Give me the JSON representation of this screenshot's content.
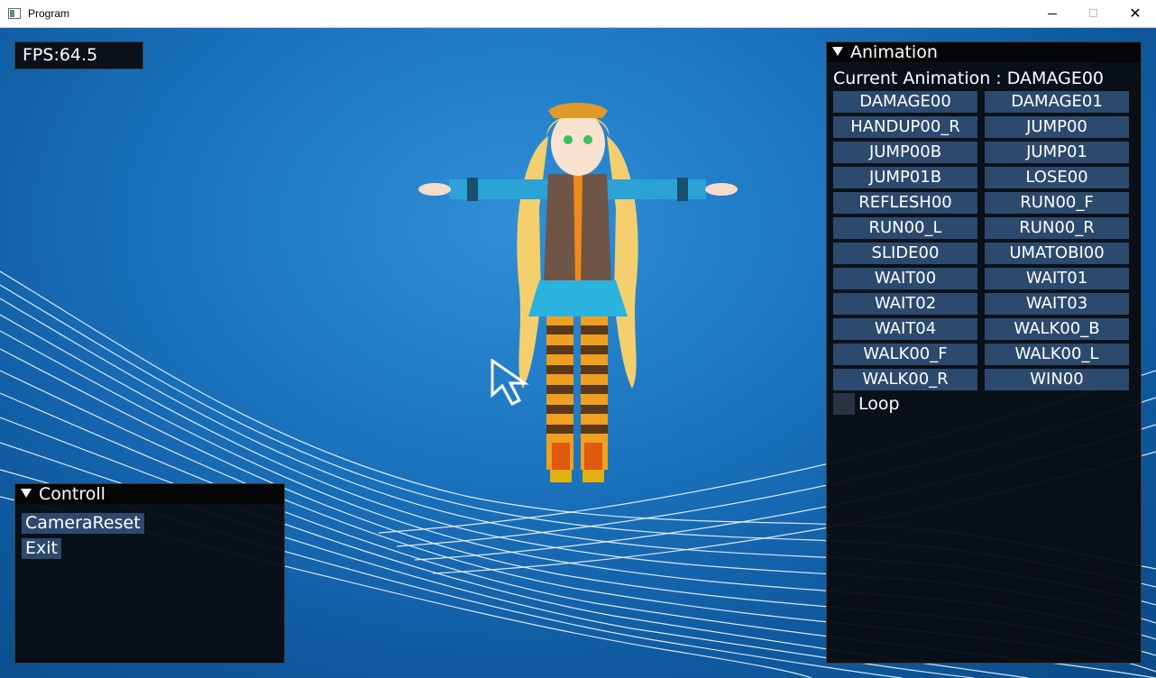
{
  "window": {
    "title": "Program",
    "minimize_glyph": "",
    "maximize_glyph": "",
    "close_glyph": "✕"
  },
  "fps": {
    "label": "FPS:64.5"
  },
  "animation_panel": {
    "header": "Animation",
    "current": "Current Animation : DAMAGE00",
    "buttons": [
      "DAMAGE00",
      "DAMAGE01",
      "HANDUP00_R",
      "JUMP00",
      "JUMP00B",
      "JUMP01",
      "JUMP01B",
      "LOSE00",
      "REFLESH00",
      "RUN00_F",
      "RUN00_L",
      "RUN00_R",
      "SLIDE00",
      "UMATOBI00",
      "WAIT00",
      "WAIT01",
      "WAIT02",
      "WAIT03",
      "WAIT04",
      "WALK00_B",
      "WALK00_F",
      "WALK00_L",
      "WALK00_R",
      "WIN00"
    ],
    "loop_label": "Loop",
    "loop_checked": false
  },
  "control_panel": {
    "header": "Controll",
    "camera_reset": "CameraReset",
    "exit": "Exit"
  },
  "colors": {
    "button_bg": "#2c4a6e",
    "panel_bg": "#0a0c10",
    "viewport_blue": "#1d76c2"
  },
  "icons": [
    "app-icon",
    "collapse-triangle-icon",
    "mouse-cursor-icon"
  ]
}
